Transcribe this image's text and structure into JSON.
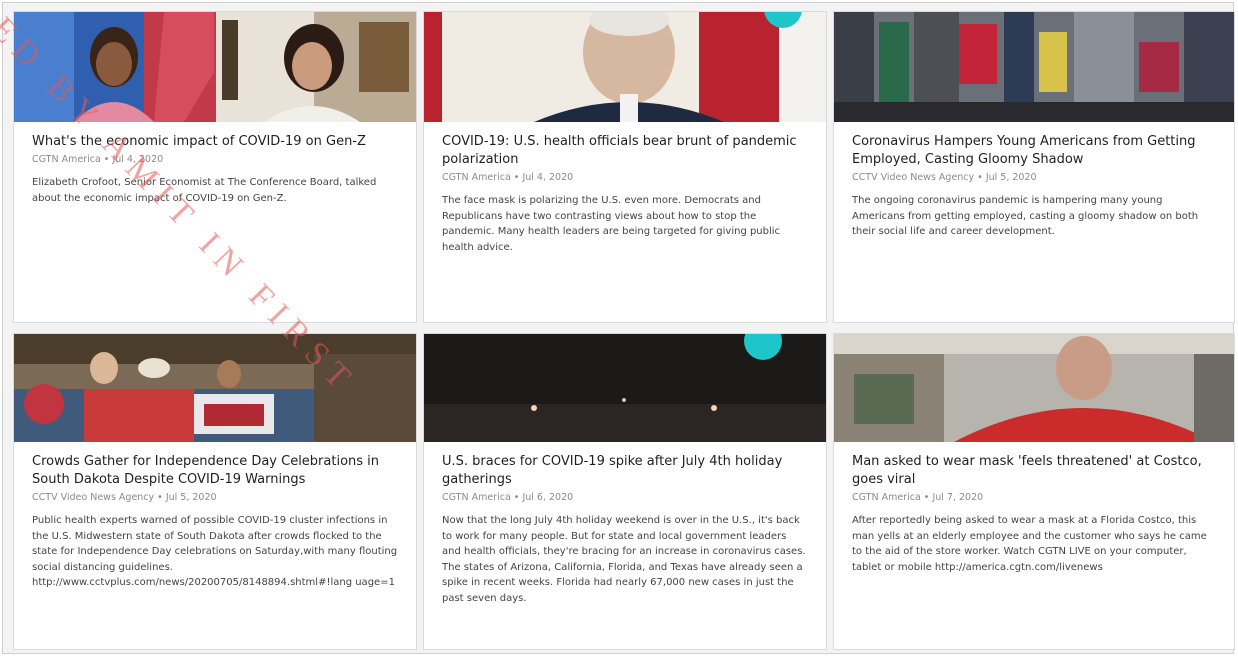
{
  "cards": [
    {
      "title": "What's the economic impact of COVID-19 on Gen-Z",
      "source": "CGTN America",
      "date": "Jul 4, 2020",
      "description": "Elizabeth Crofoot, Senior Economist at The Conference Board, talked about the economic impact of COVID-19 on Gen-Z."
    },
    {
      "title": "COVID-19: U.S. health officials bear brunt of pandemic polarization",
      "source": "CGTN America",
      "date": "Jul 4, 2020",
      "description": "The face mask is polarizing the U.S. even more. Democrats and Republicans have two contrasting views about how to stop the pandemic. Many health leaders are being targeted for giving public health advice."
    },
    {
      "title": "Coronavirus Hampers Young Americans from Getting Employed, Casting Gloomy Shadow",
      "source": "CCTV Video News Agency",
      "date": "Jul 5, 2020",
      "description": "The ongoing coronavirus pandemic is hampering many young Americans from getting employed, casting a gloomy shadow on both their social life and career development."
    },
    {
      "title": "Crowds Gather for Independence Day Celebrations in South Dakota Despite COVID-19 Warnings",
      "source": "CCTV Video News Agency",
      "date": "Jul 5, 2020",
      "description": "Public health experts warned of possible COVID-19 cluster infections in the U.S. Midwestern state of South Dakota after crowds flocked to the state for Independence Day celebrations on Saturday,with many flouting social distancing guidelines. http://www.cctvplus.com/news/20200705/8148894.shtml#!lang uage=1"
    },
    {
      "title": "U.S. braces for COVID-19 spike after July 4th holiday gatherings",
      "source": "CGTN America",
      "date": "Jul 6, 2020",
      "description": "Now that the long July 4th holiday weekend is over in the U.S., it's back to work for many people. But for state and local government leaders and health officials, they're bracing for an increase in coronavirus cases. The states of Arizona, California, Florida, and Texas have already seen a spike in recent weeks. Florida had nearly 67,000 new cases in just the past seven days."
    },
    {
      "title": "Man asked to wear mask 'feels threatened' at Costco, goes viral",
      "source": "CGTN America",
      "date": "Jul 7, 2020",
      "description": "After reportedly being asked to wear a mask at a Florida Costco, this man yells at an elderly employee and the customer who says he came to the aid of the store worker. Watch CGTN LIVE on your computer, tablet or mobile http://america.cgtn.com/livenews"
    }
  ],
  "meta_separator": " • ",
  "watermark": "ED BY AMIT IN FIRST",
  "colors": {
    "live_badge": "#1fc6c9",
    "watermark": "#e25a5a"
  }
}
